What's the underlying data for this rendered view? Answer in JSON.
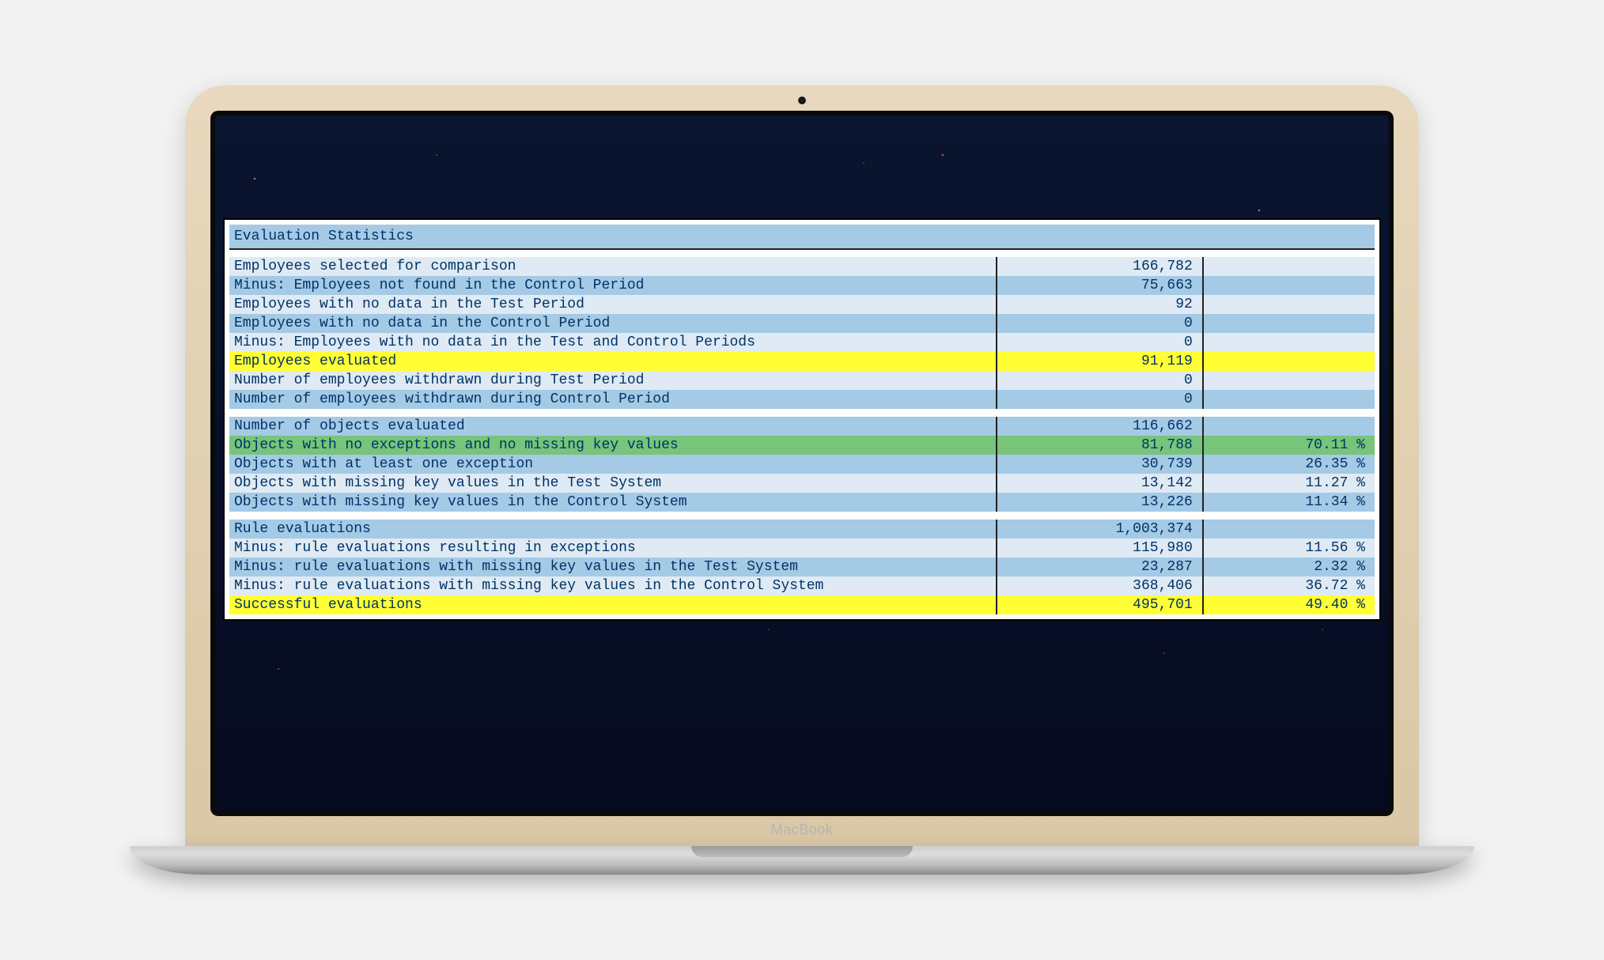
{
  "device": {
    "brand": "MacBook"
  },
  "report": {
    "title": "Evaluation Statistics",
    "section1": [
      {
        "label": "Employees selected for comparison",
        "value": "166,782",
        "pct": "",
        "style": "alt"
      },
      {
        "label": "Minus: Employees not found in the Control Period",
        "value": "75,663",
        "pct": "",
        "style": "reg"
      },
      {
        "label": "Employees with no data in the Test Period",
        "value": "92",
        "pct": "",
        "style": "alt"
      },
      {
        "label": "Employees with no data in the Control Period",
        "value": "0",
        "pct": "",
        "style": "reg"
      },
      {
        "label": "Minus: Employees with no data in the Test and Control Periods",
        "value": "0",
        "pct": "",
        "style": "alt"
      },
      {
        "label": "Employees evaluated",
        "value": "91,119",
        "pct": "",
        "style": "yel"
      },
      {
        "label": "Number of employees withdrawn during Test Period",
        "value": "0",
        "pct": "",
        "style": "alt"
      },
      {
        "label": "Number of employees withdrawn during Control Period",
        "value": "0",
        "pct": "",
        "style": "reg"
      }
    ],
    "section2": [
      {
        "label": "Number of objects evaluated",
        "value": "116,662",
        "pct": "",
        "style": "reg"
      },
      {
        "label": "Objects with no exceptions and no missing key values",
        "value": "81,788",
        "pct": "70.11 %",
        "style": "grn"
      },
      {
        "label": "Objects with at least one exception",
        "value": "30,739",
        "pct": "26.35 %",
        "style": "reg"
      },
      {
        "label": "Objects with missing key values in the Test System",
        "value": "13,142",
        "pct": "11.27 %",
        "style": "alt"
      },
      {
        "label": "Objects with missing key values in the Control System",
        "value": "13,226",
        "pct": "11.34 %",
        "style": "reg"
      }
    ],
    "section3": [
      {
        "label": "Rule evaluations",
        "value": "1,003,374",
        "pct": "",
        "style": "reg"
      },
      {
        "label": "Minus: rule evaluations resulting in exceptions",
        "value": "115,980",
        "pct": "11.56 %",
        "style": "alt"
      },
      {
        "label": "Minus: rule evaluations with missing key values in the Test System",
        "value": "23,287",
        "pct": "2.32 %",
        "style": "reg"
      },
      {
        "label": "Minus: rule evaluations with missing key values in the Control System",
        "value": "368,406",
        "pct": "36.72 %",
        "style": "alt"
      },
      {
        "label": "Successful evaluations",
        "value": "495,701",
        "pct": "49.40 %",
        "style": "yel"
      }
    ]
  }
}
